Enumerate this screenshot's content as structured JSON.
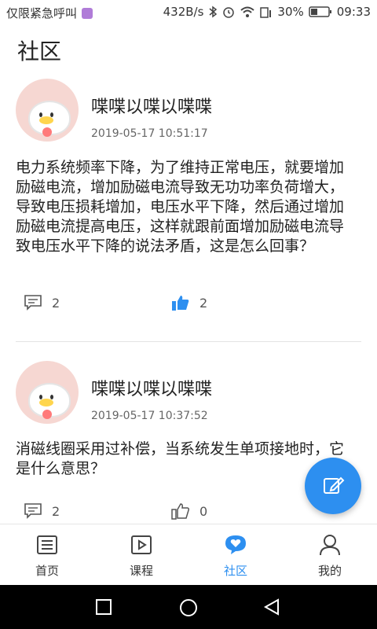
{
  "status_bar": {
    "carrier": "仅限紧急呼叫",
    "speed": "432B/s",
    "battery": "30%",
    "time": "09:33"
  },
  "page_title": "社区",
  "posts": [
    {
      "author": "喋喋以喋以喋喋",
      "time": "2019-05-17 10:51:17",
      "content": "电力系统频率下降，为了维持正常电压，就要增加励磁电流，增加励磁电流导致无功功率负荷增大，导致电压损耗增加，电压水平下降，然后通过增加励磁电流提高电压，这样就跟前面增加励磁电流导致电压水平下降的说法矛盾，这是怎么回事？",
      "comments": "2",
      "likes": "2",
      "liked": true
    },
    {
      "author": "喋喋以喋以喋喋",
      "time": "2019-05-17 10:37:52",
      "content": "消磁线圈采用过补偿，当系统发生单项接地时，它是什么意思？",
      "comments": "2",
      "likes": "0",
      "liked": false
    }
  ],
  "fab": {
    "icon": "edit-icon"
  },
  "tabs": [
    {
      "label": "首页",
      "icon": "home-list-icon"
    },
    {
      "label": "课程",
      "icon": "video-play-icon"
    },
    {
      "label": "社区",
      "icon": "community-heart-icon",
      "active": true
    },
    {
      "label": "我的",
      "icon": "user-icon"
    }
  ],
  "colors": {
    "accent": "#2d8ff0",
    "text": "#222222",
    "muted": "#666666"
  }
}
